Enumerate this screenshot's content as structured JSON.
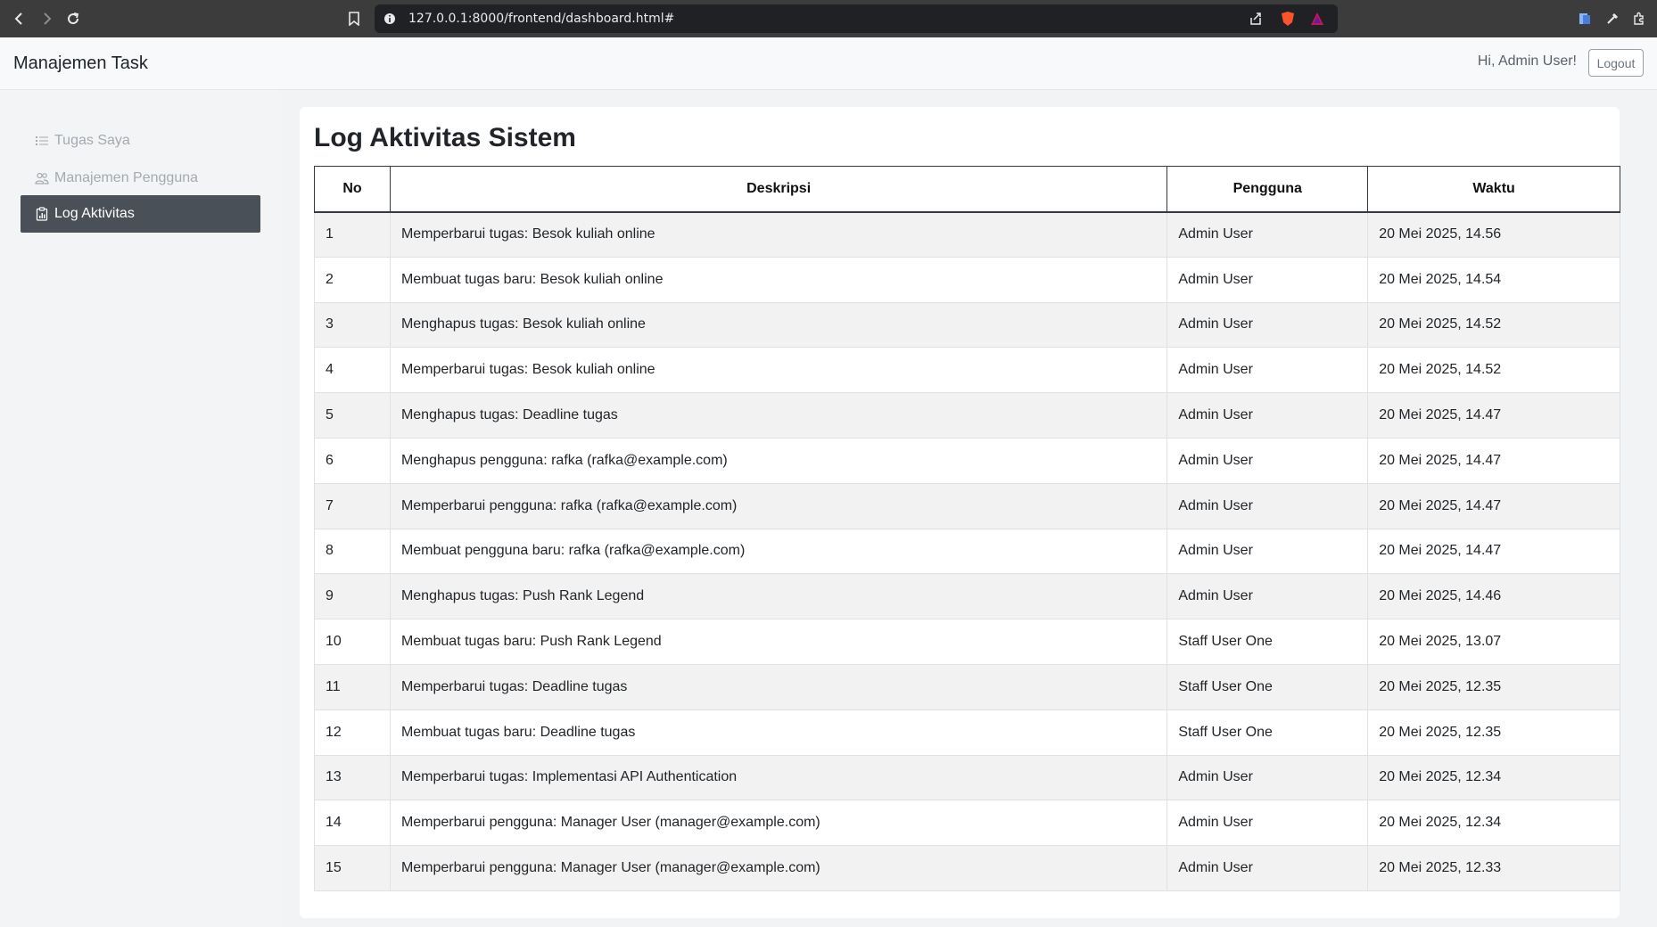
{
  "browser": {
    "url": "127.0.0.1:8000/frontend/dashboard.html#"
  },
  "header": {
    "brand": "Manajemen Task",
    "greeting": "Hi, Admin User!",
    "logout_label": "Logout"
  },
  "sidebar": {
    "items": [
      {
        "label": "Tugas Saya",
        "icon": "list-icon",
        "active": false
      },
      {
        "label": "Manajemen Pengguna",
        "icon": "users-icon",
        "active": false
      },
      {
        "label": "Log Aktivitas",
        "icon": "clipboard-data-icon",
        "active": true
      }
    ]
  },
  "main": {
    "title": "Log Aktivitas Sistem",
    "columns": [
      "No",
      "Deskripsi",
      "Pengguna",
      "Waktu"
    ],
    "rows": [
      [
        "1",
        "Memperbarui tugas: Besok kuliah online",
        "Admin User",
        "20 Mei 2025, 14.56"
      ],
      [
        "2",
        "Membuat tugas baru: Besok kuliah online",
        "Admin User",
        "20 Mei 2025, 14.54"
      ],
      [
        "3",
        "Menghapus tugas: Besok kuliah online",
        "Admin User",
        "20 Mei 2025, 14.52"
      ],
      [
        "4",
        "Memperbarui tugas: Besok kuliah online",
        "Admin User",
        "20 Mei 2025, 14.52"
      ],
      [
        "5",
        "Menghapus tugas: Deadline tugas",
        "Admin User",
        "20 Mei 2025, 14.47"
      ],
      [
        "6",
        "Menghapus pengguna: rafka (rafka@example.com)",
        "Admin User",
        "20 Mei 2025, 14.47"
      ],
      [
        "7",
        "Memperbarui pengguna: rafka (rafka@example.com)",
        "Admin User",
        "20 Mei 2025, 14.47"
      ],
      [
        "8",
        "Membuat pengguna baru: rafka (rafka@example.com)",
        "Admin User",
        "20 Mei 2025, 14.47"
      ],
      [
        "9",
        "Menghapus tugas: Push Rank Legend",
        "Admin User",
        "20 Mei 2025, 14.46"
      ],
      [
        "10",
        "Membuat tugas baru: Push Rank Legend",
        "Staff User One",
        "20 Mei 2025, 13.07"
      ],
      [
        "11",
        "Memperbarui tugas: Deadline tugas",
        "Staff User One",
        "20 Mei 2025, 12.35"
      ],
      [
        "12",
        "Membuat tugas baru: Deadline tugas",
        "Staff User One",
        "20 Mei 2025, 12.35"
      ],
      [
        "13",
        "Memperbarui tugas: Implementasi API Authentication",
        "Admin User",
        "20 Mei 2025, 12.34"
      ],
      [
        "14",
        "Memperbarui pengguna: Manager User (manager@example.com)",
        "Admin User",
        "20 Mei 2025, 12.34"
      ],
      [
        "15",
        "Memperbarui pengguna: Manager User (manager@example.com)",
        "Admin User",
        "20 Mei 2025, 12.33"
      ]
    ]
  }
}
